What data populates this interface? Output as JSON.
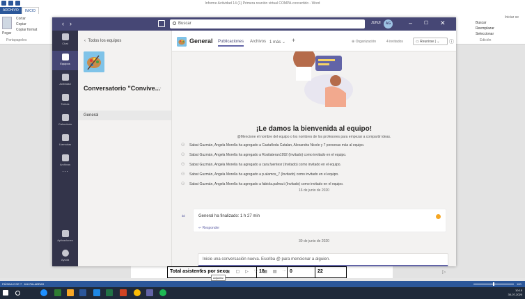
{
  "word": {
    "title": "Informe Actividad 14 (1) Primera reunión virtual COMPA-convertido - Word",
    "tabs": [
      "ARCHIVO",
      "INICIO"
    ],
    "ribbon": {
      "cut": "Cortar",
      "copy": "Copiar",
      "paste": "Pegar",
      "format_painter": "Copiar format",
      "clipboard_group": "Portapapeles",
      "find": "Buscar",
      "replace": "Reemplazar",
      "select": "Seleccionar",
      "editing_group": "Edición",
      "sign_in": "Iniciar se"
    },
    "table_row": {
      "label": "Total asistentes por sexo",
      "a": "18",
      "b": "0",
      "c": "22"
    },
    "status": {
      "page": "PÁGINA 2 DE 7",
      "words": "616 PALABRAS",
      "zoom": "100"
    },
    "taskbar": {
      "time": "10:15",
      "date": "30-07-2020"
    }
  },
  "teams": {
    "search_placeholder": "Buscar",
    "user_label": "JUNJI",
    "avatar_initials": "AG",
    "rail": [
      {
        "label": "Chat"
      },
      {
        "label": "Equipos"
      },
      {
        "label": "Actividad"
      },
      {
        "label": "Tareas"
      },
      {
        "label": "Calendario"
      },
      {
        "label": "Llamadas"
      },
      {
        "label": "Archivos"
      },
      {
        "label": "Aplicaciones"
      },
      {
        "label": "Ayuda"
      }
    ],
    "all_teams": "Todos los equipos",
    "team_name": "Conversatorio \"Convive...",
    "channel": "General",
    "header": {
      "name": "General",
      "tabs": [
        "Publicaciones",
        "Archivos",
        "1 más"
      ],
      "add": "+",
      "org": "Organización",
      "guests": "4 invitados",
      "meet": "Reunirse"
    },
    "welcome_title": "¡Le damos la bienvenida al equipo!",
    "welcome_sub": "@Mencione el nombre del equipo o los nombres de los profesores para empezar a compartir ideas.",
    "events": [
      "Sabat Guzmán, Angela Morella ha agregado a Castañeda Catalan, Alexandra Nicole y 7 personas más al equipo.",
      "Sabat Guzmán, Angela Morella ha agregado a Rositateran1992 (Invitado) como invitado en el equipo.",
      "Sabat Guzmán, Angela Morella ha agregado a cara.fuentesr (Invitado) como invitado en el equipo.",
      "Sabat Guzmán, Angela Morella ha agregado a p.alamos_7 (Invitado) como invitado en el equipo.",
      "Sabat Guzmán, Angela Morella ha agregado a fabiola.palma.t (Invitado) como invitado en el equipo."
    ],
    "date1": "16 de junio de 2020",
    "meeting_text": "General ha finalizado: 1 h 27 min",
    "reply": "Responder",
    "date2": "30 de junio de 2020",
    "compose_placeholder": "Inicie una conversación nueva. Escriba @ para mencionar a alguien.",
    "tooltip": "Adjuntar"
  }
}
